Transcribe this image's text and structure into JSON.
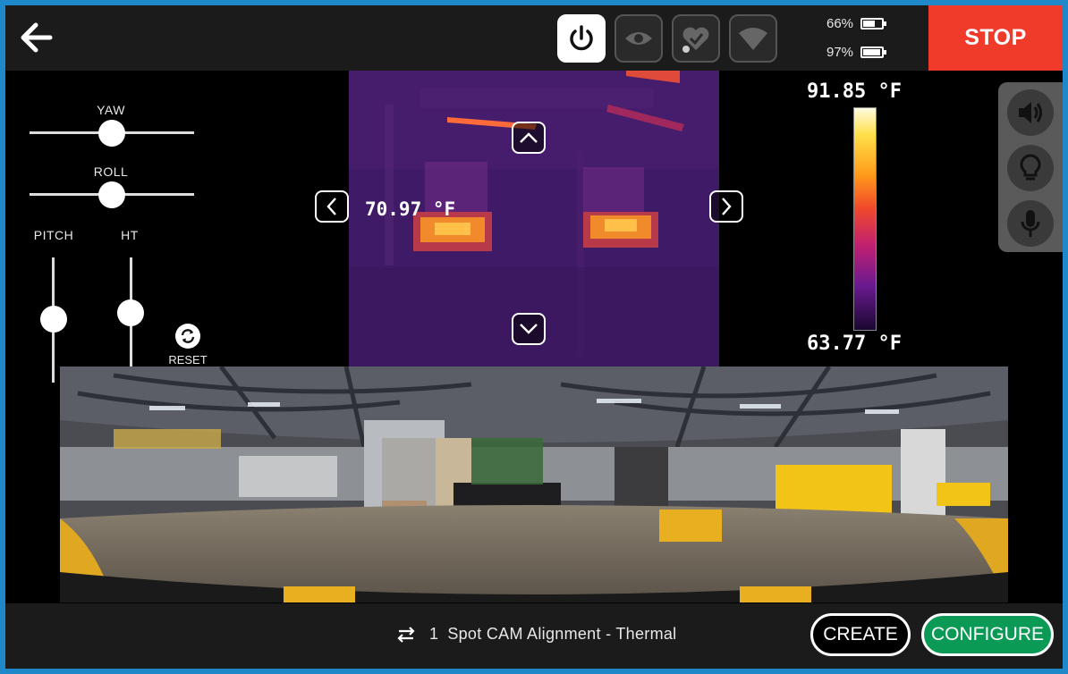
{
  "topbar": {
    "battery": [
      {
        "percent_label": "66%",
        "level": 0.66
      },
      {
        "percent_label": "97%",
        "level": 0.97
      }
    ],
    "stop_label": "STOP"
  },
  "controls": {
    "yaw_label": "YAW",
    "roll_label": "ROLL",
    "pitch_label": "PITCH",
    "height_label": "HT",
    "reset_label": "RESET"
  },
  "thermal": {
    "spot_temperature": "70.97 °F",
    "scale_max": "91.85 °F",
    "scale_min": "63.77 °F"
  },
  "mission": {
    "index": "1",
    "name": "Spot CAM Alignment - Thermal"
  },
  "actions": {
    "create_label": "CREATE",
    "configure_label": "CONFIGURE"
  },
  "colors": {
    "stop": "#f03a2a",
    "configure": "#0a9a55",
    "frame": "#1e88c8"
  }
}
